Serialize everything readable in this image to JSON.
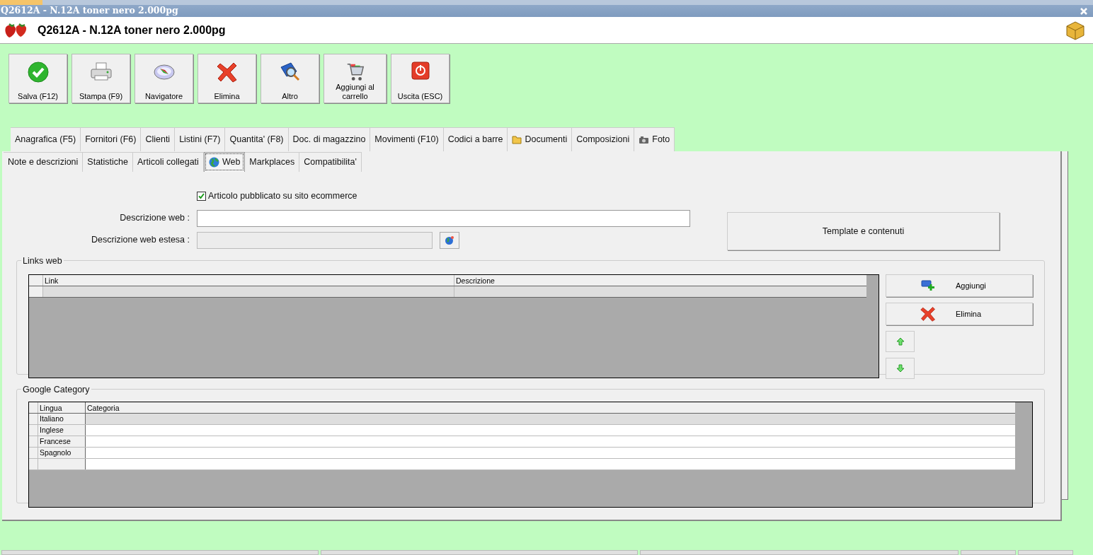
{
  "window": {
    "title": "Q2612A - N.12A toner nero 2.000pg"
  },
  "header": {
    "title": "Q2612A - N.12A toner nero 2.000pg"
  },
  "toolbar": [
    {
      "label": "Salva (F12)",
      "kind": "save"
    },
    {
      "label": "Stampa (F9)",
      "kind": "print"
    },
    {
      "label": "Navigatore",
      "kind": "compass"
    },
    {
      "label": "Elimina",
      "kind": "delete"
    },
    {
      "label": "Altro",
      "kind": "search"
    },
    {
      "label": "Aggiungi al carrello",
      "kind": "cart"
    },
    {
      "label": "Uscita (ESC)",
      "kind": "exit"
    }
  ],
  "tabs_row1": [
    {
      "label": "Anagrafica (F5)",
      "selected": false,
      "kind": "plain"
    },
    {
      "label": "Fornitori (F6)",
      "selected": false,
      "kind": "plain"
    },
    {
      "label": "Clienti",
      "selected": false,
      "kind": "plain"
    },
    {
      "label": "Listini (F7)",
      "selected": false,
      "kind": "plain"
    },
    {
      "label": "Quantita' (F8)",
      "selected": false,
      "kind": "plain"
    },
    {
      "label": "Doc. di magazzino",
      "selected": false,
      "kind": "plain"
    },
    {
      "label": "Movimenti (F10)",
      "selected": false,
      "kind": "plain"
    },
    {
      "label": "Codici a barre",
      "selected": false,
      "kind": "plain"
    },
    {
      "label": "Documenti",
      "selected": false,
      "kind": "folder"
    },
    {
      "label": "Composizioni",
      "selected": false,
      "kind": "plain"
    },
    {
      "label": "Foto",
      "selected": false,
      "kind": "camera"
    }
  ],
  "tabs_row2": [
    {
      "label": "Note e descrizioni",
      "selected": false,
      "kind": "plain"
    },
    {
      "label": "Statistiche",
      "selected": false,
      "kind": "plain"
    },
    {
      "label": "Articoli collegati",
      "selected": false,
      "kind": "plain"
    },
    {
      "label": "Web",
      "selected": true,
      "kind": "globe"
    },
    {
      "label": "Markplaces",
      "selected": false,
      "kind": "plain"
    },
    {
      "label": "Compatibilita'",
      "selected": false,
      "kind": "plain"
    }
  ],
  "web": {
    "published": {
      "label": "Articolo pubblicato su sito ecommerce",
      "checked": true
    },
    "description": {
      "label": "Descrizione web :",
      "disabled": false
    },
    "extended_description": {
      "label": "Descrizione web estesa :",
      "disabled": true
    },
    "template_button": "Template e contenuti"
  },
  "links": {
    "title": "Links web",
    "columns": [
      "Link",
      "Descrizione"
    ],
    "rows": [
      {
        "selected": true
      }
    ],
    "buttons": [
      {
        "label": "Aggiungi",
        "kind": "add"
      },
      {
        "label": "Elimina",
        "kind": "delete"
      }
    ]
  },
  "google_category": {
    "title": "Google Category",
    "columns": [
      "Lingua",
      "Categoria"
    ],
    "rows": [
      {
        "lingua": "Italiano",
        "selected": true
      },
      {
        "lingua": "Inglese",
        "selected": false
      },
      {
        "lingua": "Francese",
        "selected": false
      },
      {
        "lingua": "Spagnolo",
        "selected": false
      },
      {
        "selected": false
      }
    ]
  }
}
